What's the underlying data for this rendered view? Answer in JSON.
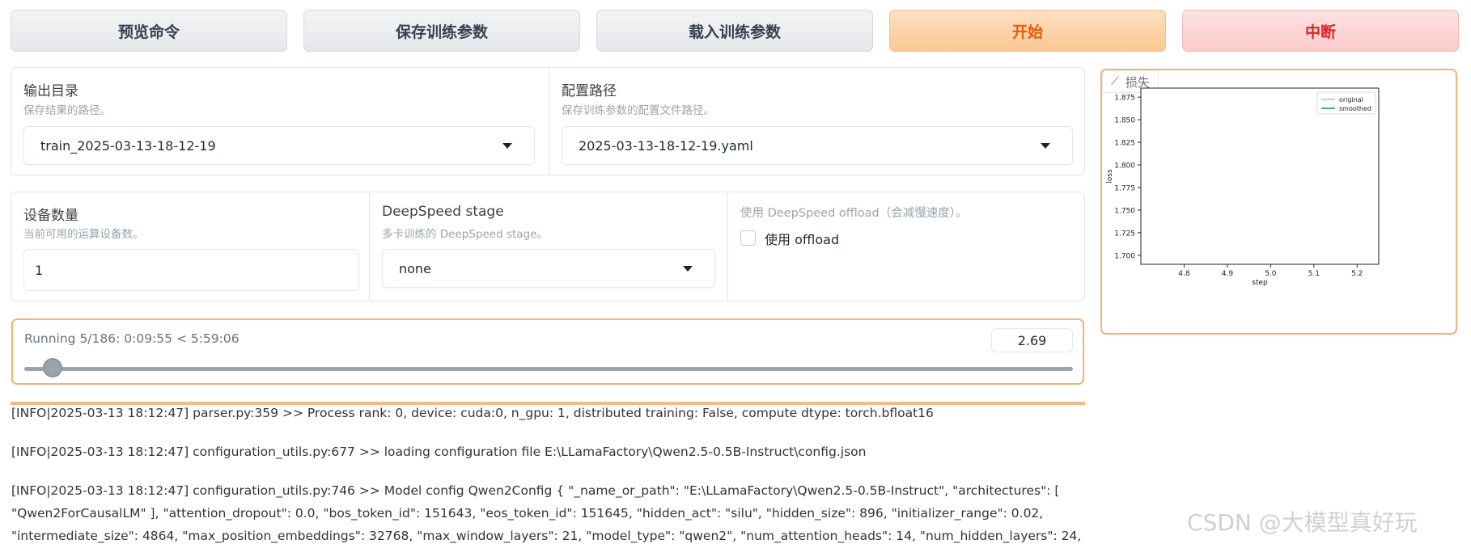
{
  "buttons": {
    "preview": "预览命令",
    "save": "保存训练参数",
    "load": "载入训练参数",
    "start": "开始",
    "stop": "中断"
  },
  "output_dir": {
    "label": "输出目录",
    "hint": "保存结果的路径。",
    "value": "train_2025-03-13-18-12-19"
  },
  "config_path": {
    "label": "配置路径",
    "hint": "保存训练参数的配置文件路径。",
    "value": "2025-03-13-18-12-19.yaml"
  },
  "device_count": {
    "label": "设备数量",
    "hint": "当前可用的运算设备数。",
    "value": "1"
  },
  "ds_stage": {
    "label": "DeepSpeed stage",
    "hint": "多卡训练的 DeepSpeed stage。",
    "value": "none"
  },
  "ds_offload": {
    "hint": "使用 DeepSpeed offload（会减慢速度）。",
    "checkbox_label": "使用 offload",
    "checked": false
  },
  "progress": {
    "text": "Running 5/186: 0:09:55 < 5:59:06",
    "value": "2.69",
    "fraction": 0.027
  },
  "logs": [
    "[INFO|2025-03-13 18:12:47] parser.py:359 >> Process rank: 0, device: cuda:0, n_gpu: 1, distributed training: False, compute dtype: torch.bfloat16",
    "[INFO|2025-03-13 18:12:47] configuration_utils.py:677 >> loading configuration file E:\\LLamaFactory\\Qwen2.5-0.5B-Instruct\\config.json",
    "[INFO|2025-03-13 18:12:47] configuration_utils.py:746 >> Model config Qwen2Config { \"_name_or_path\": \"E:\\LLamaFactory\\Qwen2.5-0.5B-Instruct\", \"architectures\": [",
    "\"Qwen2ForCausalLM\" ], \"attention_dropout\": 0.0, \"bos_token_id\": 151643, \"eos_token_id\": 151645, \"hidden_act\": \"silu\", \"hidden_size\": 896, \"initializer_range\": 0.02,",
    "\"intermediate_size\": 4864, \"max_position_embeddings\": 32768, \"max_window_layers\": 21, \"model_type\": \"qwen2\", \"num_attention_heads\": 14, \"num_hidden_layers\": 24,"
  ],
  "chart_tab": "损失",
  "chart_data": {
    "type": "line",
    "xlabel": "step",
    "ylabel": "loss",
    "xlim": [
      4.7,
      5.25
    ],
    "ylim": [
      1.69,
      1.885
    ],
    "xticks": [
      "4.8",
      "4.9",
      "5.0",
      "5.1",
      "5.2"
    ],
    "yticks": [
      "1.700",
      "1.725",
      "1.750",
      "1.775",
      "1.800",
      "1.825",
      "1.850",
      "1.875"
    ],
    "legend_position": "top-right",
    "series": [
      {
        "name": "original",
        "color": "#a8c4dc",
        "x": [],
        "y": []
      },
      {
        "name": "smoothed",
        "color": "#1f77b4",
        "x": [],
        "y": []
      }
    ]
  },
  "watermark": "CSDN @大模型真好玩"
}
